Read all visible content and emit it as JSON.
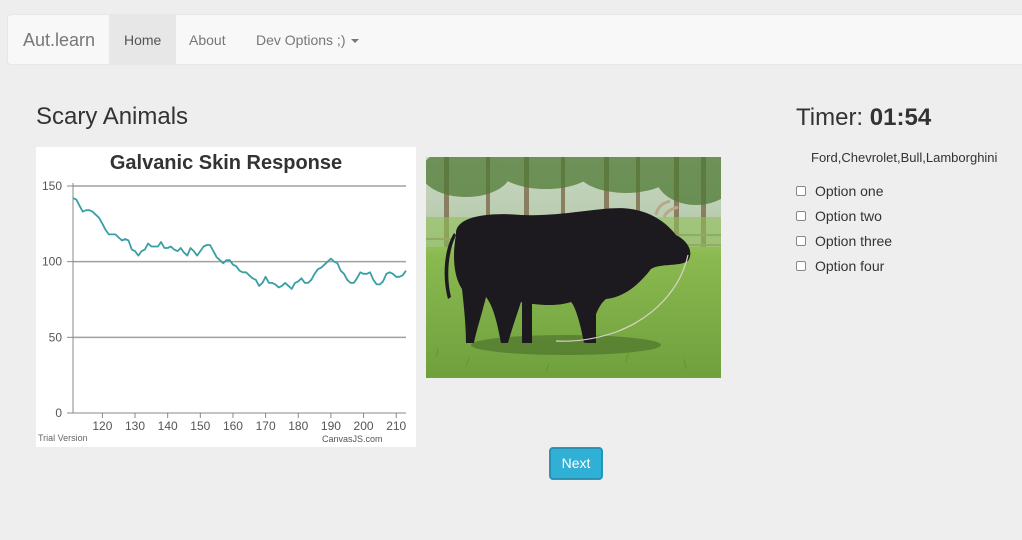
{
  "navbar": {
    "brand": "Aut.learn",
    "items": [
      {
        "label": "Home",
        "active": true
      },
      {
        "label": "About",
        "active": false
      },
      {
        "label": "Dev Options ;)",
        "active": false,
        "dropdown": true
      }
    ]
  },
  "page": {
    "title": "Scary Animals",
    "image_alt": "Black bull standing in grass"
  },
  "timer": {
    "label": "Timer:",
    "value": "01:54"
  },
  "question": {
    "choices_text": "Ford,Chevrolet,Bull,Lamborghini",
    "options": [
      "Option one",
      "Option two",
      "Option three",
      "Option four"
    ]
  },
  "buttons": {
    "next_label": "Next"
  },
  "colors": {
    "series": "#3a9ea5",
    "button": "#31b0d5"
  },
  "chart_data": {
    "type": "line",
    "title": "Galvanic Skin Response",
    "xlabel": "",
    "ylabel": "",
    "xlim": [
      111,
      213
    ],
    "ylim": [
      0,
      150
    ],
    "x_ticks": [
      120,
      130,
      140,
      150,
      160,
      170,
      180,
      190,
      200,
      210
    ],
    "y_ticks": [
      0,
      50,
      100,
      150
    ],
    "grid": true,
    "watermark_left": "Trial Version",
    "watermark_right": "CanvasJS.com",
    "series": [
      {
        "x": [
          111,
          112,
          113,
          114,
          115,
          116,
          117,
          118,
          119,
          120,
          121,
          122,
          123,
          124,
          125,
          126,
          127,
          128,
          129,
          130,
          131,
          132,
          133,
          134,
          135,
          136,
          137,
          138,
          139,
          140,
          141,
          142,
          143,
          144,
          145,
          146,
          147,
          148,
          149,
          150,
          151,
          152,
          153,
          154,
          155,
          156,
          157,
          158,
          159,
          160,
          161,
          162,
          163,
          164,
          165,
          166,
          167,
          168,
          169,
          170,
          171,
          172,
          173,
          174,
          175,
          176,
          177,
          178,
          179,
          180,
          181,
          182,
          183,
          184,
          185,
          186,
          187,
          188,
          189,
          190,
          191,
          192,
          193,
          194,
          195,
          196,
          197,
          198,
          199,
          200,
          201,
          202,
          203,
          204,
          205,
          206,
          207,
          208,
          209,
          210,
          211,
          212,
          213
        ],
        "y": [
          142,
          141,
          137,
          133,
          134,
          134,
          133,
          131,
          129,
          125,
          121,
          118,
          118,
          118,
          116,
          114,
          115,
          114,
          108,
          107,
          104,
          107,
          108,
          112,
          110,
          110,
          110,
          113,
          109,
          109,
          110,
          108,
          107,
          109,
          106,
          104,
          109,
          107,
          104,
          107,
          110,
          111,
          111,
          107,
          103,
          101,
          99,
          101,
          101,
          98,
          97,
          94,
          93,
          93,
          91,
          89,
          88,
          84,
          86,
          90,
          86,
          86,
          85,
          83,
          84,
          86,
          84,
          82,
          86,
          87,
          89,
          86,
          86,
          88,
          92,
          95,
          96,
          98,
          100,
          102,
          100,
          99,
          94,
          92,
          88,
          86,
          86,
          89,
          93,
          92,
          92,
          93,
          88,
          85,
          85,
          87,
          92,
          93,
          92,
          90,
          90,
          91,
          94
        ]
      }
    ]
  }
}
